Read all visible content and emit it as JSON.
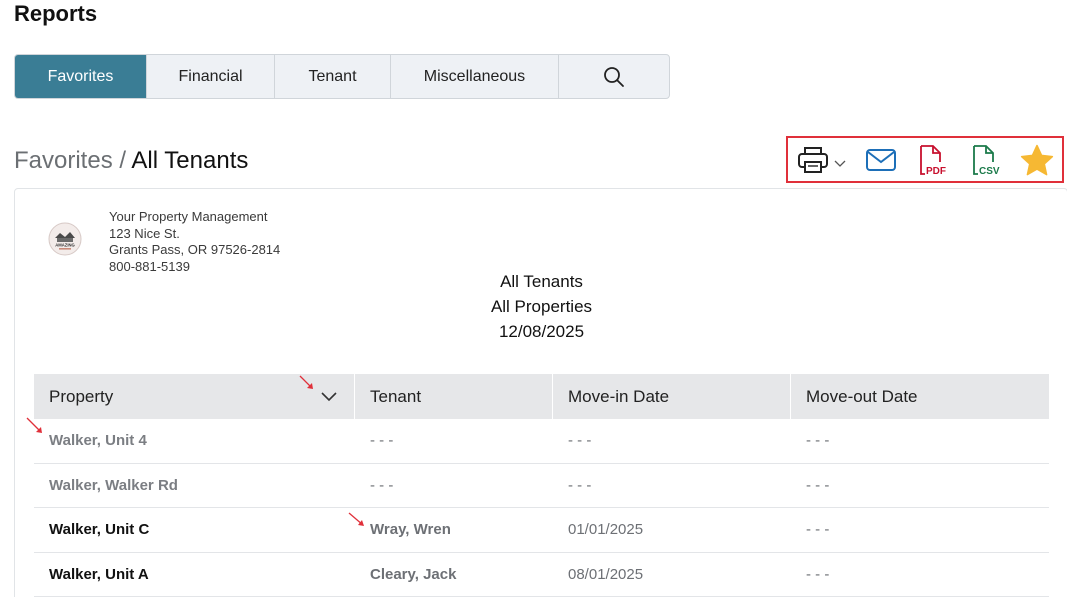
{
  "page": {
    "title": "Reports"
  },
  "tabs": [
    {
      "label": "Favorites",
      "active": true
    },
    {
      "label": "Financial",
      "active": false
    },
    {
      "label": "Tenant",
      "active": false
    },
    {
      "label": "Miscellaneous",
      "active": false
    },
    {
      "icon": "search-icon"
    }
  ],
  "breadcrumb": {
    "parent": "Favorites",
    "separator": "/",
    "current": "All Tenants"
  },
  "toolbar": {
    "icons": [
      "printer-icon",
      "chevron-down-icon",
      "email-icon",
      "pdf-icon",
      "csv-icon",
      "star-icon"
    ],
    "pdf_text": "PDF",
    "csv_text": "CSV",
    "colors": {
      "print": "#222222",
      "email": "#1d6fb8",
      "pdf": "#c8102e",
      "csv": "#1b7a4a",
      "star": "#f6b833",
      "highlight": "#e0303a"
    }
  },
  "company": {
    "name": "Your Property Management",
    "address1": "123 Nice St.",
    "address2": "Grants Pass, OR 97526-2814",
    "phone": "800-881-5139",
    "logo_text": "AMAZING"
  },
  "report": {
    "title": "All Tenants",
    "scope": "All Properties",
    "date": "12/08/2025"
  },
  "table": {
    "headers": {
      "property": "Property",
      "tenant": "Tenant",
      "move_in": "Move-in Date",
      "move_out": "Move-out Date"
    },
    "rows": [
      {
        "property": "Walker, Unit 4",
        "tenant": "- - -",
        "move_in": "- - -",
        "move_out": "- - -",
        "occupied": false
      },
      {
        "property": "Walker, Walker Rd",
        "tenant": "- - -",
        "move_in": "- - -",
        "move_out": "- - -",
        "occupied": false
      },
      {
        "property": "Walker, Unit C",
        "tenant": "Wray, Wren",
        "move_in": "01/01/2025",
        "move_out": "- - -",
        "occupied": true
      },
      {
        "property": "Walker, Unit A",
        "tenant": "Cleary, Jack",
        "move_in": "08/01/2025",
        "move_out": "- - -",
        "occupied": true
      }
    ]
  },
  "colors": {
    "active_tab": "#3a7d95",
    "annotation_arrow": "#e0303a"
  }
}
